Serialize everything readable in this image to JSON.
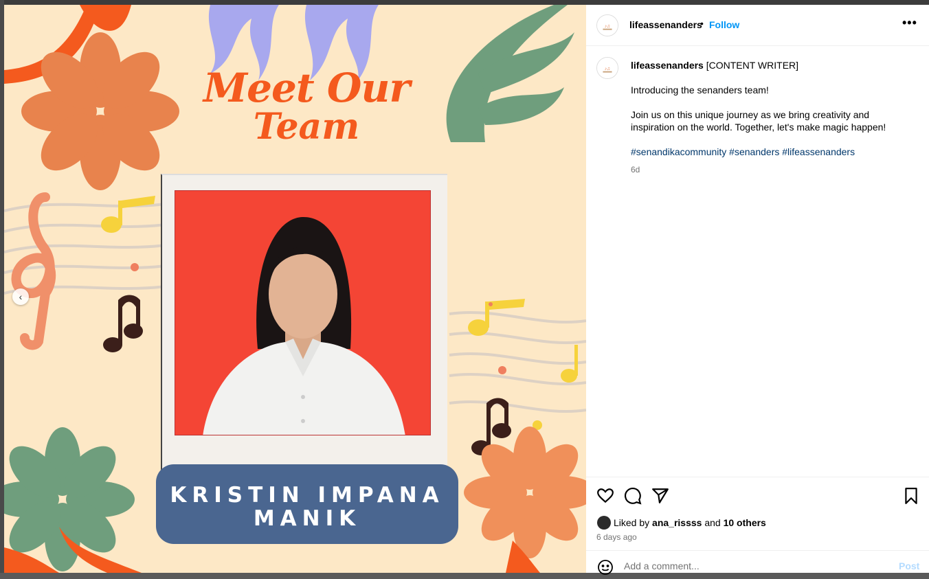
{
  "post": {
    "image": {
      "headline_line1": "Meet Our",
      "headline_line2": "Team",
      "member_name_line1": "KRISTIN IMPANA",
      "member_name_line2": "MANIK",
      "prev_icon": "chevron-left-icon",
      "colors": {
        "background": "#fde8c6",
        "orange": "#f45a1e",
        "nameplate": "#4a6690",
        "photo_bg": "#f44535"
      }
    },
    "header": {
      "username": "lifeassenanders",
      "separator": "•",
      "follow_label": "Follow",
      "more_icon": "more-horizontal-icon"
    },
    "caption": {
      "username": "lifeassenanders",
      "role": "[CONTENT WRITER]",
      "line1": "Introducing the senanders team!",
      "line2": "Join us on this unique journey as we bring creativity and inspiration on the world. Together, let's make magic happen!",
      "hashtags": "#senandikacommunity #senanders #lifeassenanders",
      "time": "6d"
    },
    "actions": {
      "like_icon": "heart-icon",
      "comment_icon": "comment-icon",
      "share_icon": "send-icon",
      "save_icon": "bookmark-icon"
    },
    "likes": {
      "prefix": "Liked by",
      "user": "ana_rissss",
      "and": "and",
      "others": "10 others"
    },
    "ago": "6 days ago",
    "comment": {
      "placeholder": "Add a comment...",
      "post_label": "Post",
      "emoji_icon": "emoji-icon"
    }
  }
}
